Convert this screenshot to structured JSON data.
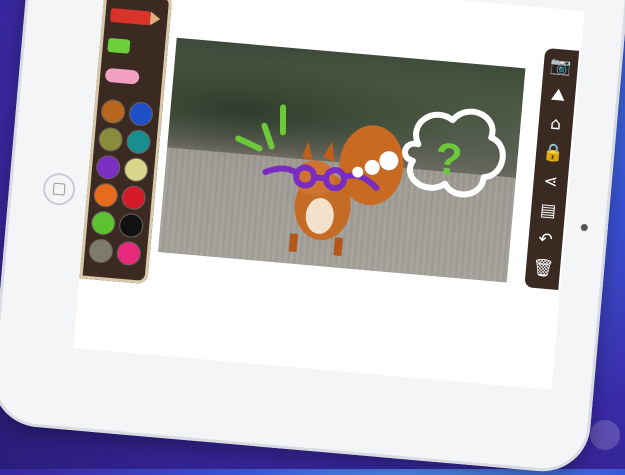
{
  "app": {
    "title": ""
  },
  "colors": {
    "frame": "#3a2a22",
    "frame_border": "#d9c9a8",
    "screen": "#ffffff",
    "doodle_purple": "#7a2bc2",
    "doodle_green": "#6cc93a"
  },
  "tools": [
    {
      "name": "pencil",
      "color": "#d8342a"
    },
    {
      "name": "marker",
      "color": "#6ccf3c"
    },
    {
      "name": "brush",
      "color": "#f2a1c2"
    }
  ],
  "palette": [
    {
      "color": "#b8661d"
    },
    {
      "color": "#1f4fc9"
    },
    {
      "color": "#8a8c3b"
    },
    {
      "color": "#198e8e"
    },
    {
      "color": "#7b2ec2"
    },
    {
      "color": "#d8d68a"
    },
    {
      "color": "#e86a1c"
    },
    {
      "color": "#d61a2a"
    },
    {
      "color": "#5cc22f"
    },
    {
      "color": "#111111"
    },
    {
      "color": "#7f7b6c"
    },
    {
      "color": "#e9297c"
    }
  ],
  "toolbar": [
    {
      "icon": "camera-icon",
      "glyph": "📷"
    },
    {
      "icon": "image-icon",
      "glyph": "⛰"
    },
    {
      "icon": "home-icon",
      "glyph": "⌂"
    },
    {
      "icon": "lock-icon",
      "glyph": "🔒"
    },
    {
      "icon": "share-icon",
      "glyph": "⋖"
    },
    {
      "icon": "page-icon",
      "glyph": "▤"
    },
    {
      "icon": "undo-icon",
      "glyph": "↶"
    },
    {
      "icon": "trash-icon",
      "glyph": "🗑"
    }
  ],
  "doodle": {
    "question_mark": "?"
  }
}
